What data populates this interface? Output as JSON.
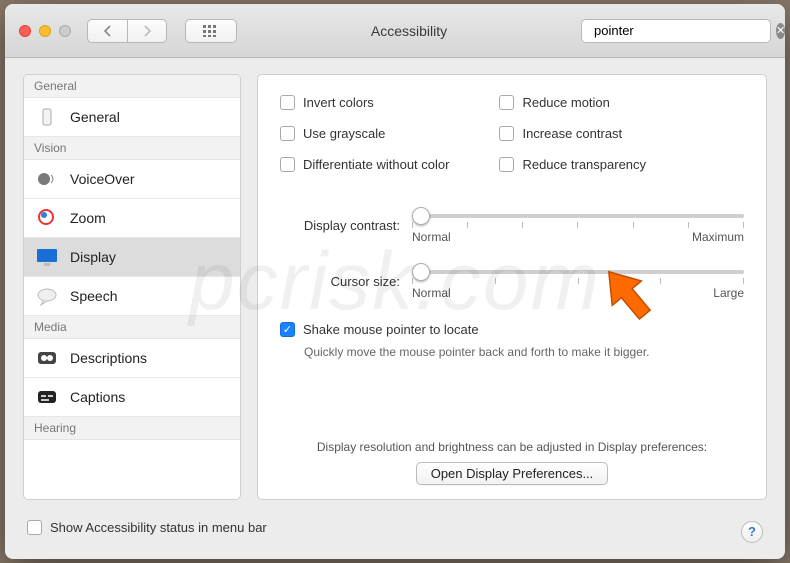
{
  "titlebar": {
    "title": "Accessibility",
    "search_value": "pointer"
  },
  "sidebar": {
    "sections": [
      {
        "header": "General",
        "items": [
          {
            "label": "General",
            "selected": false
          }
        ]
      },
      {
        "header": "Vision",
        "items": [
          {
            "label": "VoiceOver",
            "selected": false
          },
          {
            "label": "Zoom",
            "selected": false
          },
          {
            "label": "Display",
            "selected": true
          },
          {
            "label": "Speech",
            "selected": false
          }
        ]
      },
      {
        "header": "Media",
        "items": [
          {
            "label": "Descriptions",
            "selected": false
          },
          {
            "label": "Captions",
            "selected": false
          }
        ]
      },
      {
        "header": "Hearing",
        "items": []
      }
    ]
  },
  "panel": {
    "col1": {
      "invert": "Invert colors",
      "grayscale": "Use grayscale",
      "diffcolor": "Differentiate without color"
    },
    "col2": {
      "reduce_motion": "Reduce motion",
      "increase_contrast": "Increase contrast",
      "reduce_transparency": "Reduce transparency"
    },
    "contrast_label": "Display contrast:",
    "contrast_min": "Normal",
    "contrast_max": "Maximum",
    "cursor_label": "Cursor size:",
    "cursor_min": "Normal",
    "cursor_max": "Large",
    "shake_label": "Shake mouse pointer to locate",
    "shake_help": "Quickly move the mouse pointer back and forth to make it bigger.",
    "bottom_text": "Display resolution and brightness can be adjusted in Display preferences:",
    "open_display": "Open Display Preferences..."
  },
  "footer": {
    "menubar": "Show Accessibility status in menu bar",
    "help": "?"
  },
  "watermark": "pcrisk.com"
}
